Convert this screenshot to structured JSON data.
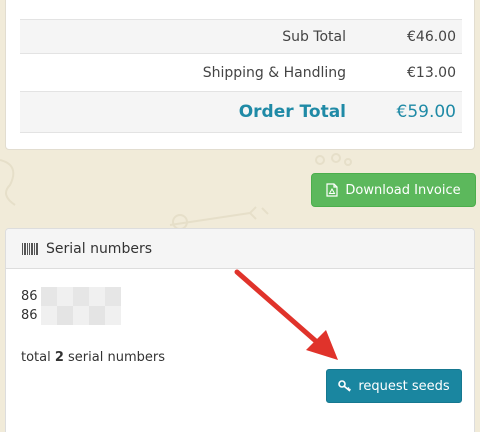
{
  "totals": {
    "sub_total_label": "Sub Total",
    "sub_total_value": "€46.00",
    "shipping_label": "Shipping & Handling",
    "shipping_value": "€13.00",
    "order_total_label": "Order Total",
    "order_total_value": "€59.00"
  },
  "download_invoice": {
    "label": "Download Invoice",
    "icon": "file-pdf-icon",
    "color": "#5cb85c"
  },
  "serial_numbers": {
    "title": "Serial numbers",
    "icon": "barcode-icon",
    "items": [
      "86",
      "86"
    ],
    "total_prefix": "total ",
    "total_count": "2",
    "total_suffix": " serial numbers",
    "request_button_label": "request seeds",
    "request_button_icon": "key-icon",
    "request_button_color": "#1a86a0"
  },
  "accent_color": "#1f8aa6",
  "annotation_arrow_color": "#e0332b"
}
